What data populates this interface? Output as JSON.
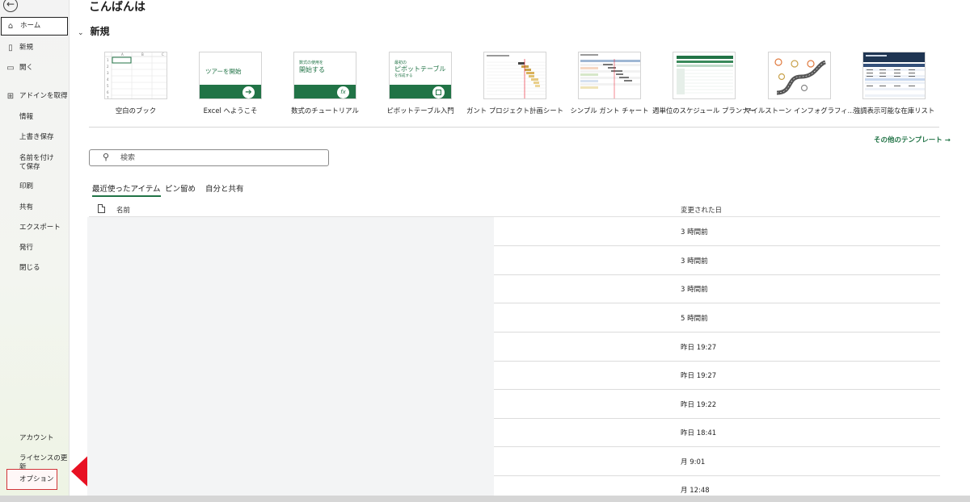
{
  "greeting": "こんばんは",
  "sidebar": {
    "home": "ホーム",
    "new": "新規",
    "open": "開く",
    "get_addins": "アドインを取得",
    "info": "情報",
    "save": "上書き保存",
    "save_as": "名前を付けて保存",
    "print": "印刷",
    "share": "共有",
    "export": "エクスポート",
    "publish": "発行",
    "close": "閉じる",
    "account": "アカウント",
    "license_update": "ライセンスの更新",
    "options": "オプション"
  },
  "new_section": {
    "title": "新規",
    "templates": [
      {
        "name": "空白のブック"
      },
      {
        "name": "Excel へようこそ",
        "thumb_text": "ツアーを開始"
      },
      {
        "name": "数式のチュートリアル",
        "thumb_small": "数式の使用を",
        "thumb_text": "開始する"
      },
      {
        "name": "ピボットテーブル入門",
        "thumb_small": "最初の",
        "thumb_text": "ピボットテーブル",
        "thumb_sub": "を作成する"
      },
      {
        "name": "ガント プロジェクト計画シート"
      },
      {
        "name": "シンプル ガント チャート"
      },
      {
        "name": "週単位のスケジュール プランナー"
      },
      {
        "name": "マイルストーン インフォグラフィ…"
      },
      {
        "name": "強調表示可能な在庫リスト"
      }
    ],
    "more_templates": "その他のテンプレート →"
  },
  "search": {
    "placeholder": "検索"
  },
  "tabs": [
    "最近使ったアイテム",
    "ピン留め",
    "自分と共有"
  ],
  "list": {
    "col_name": "名前",
    "col_modified": "変更された日",
    "dates": [
      "3 時間前",
      "3 時間前",
      "3 時間前",
      "5 時間前",
      "昨日 19:27",
      "昨日 19:27",
      "昨日 19:22",
      "昨日 18:41",
      "月 9:01",
      "月 12:48"
    ]
  },
  "colors": {
    "accent": "#217346",
    "highlight": "#d13438",
    "arrow": "#e81123"
  }
}
